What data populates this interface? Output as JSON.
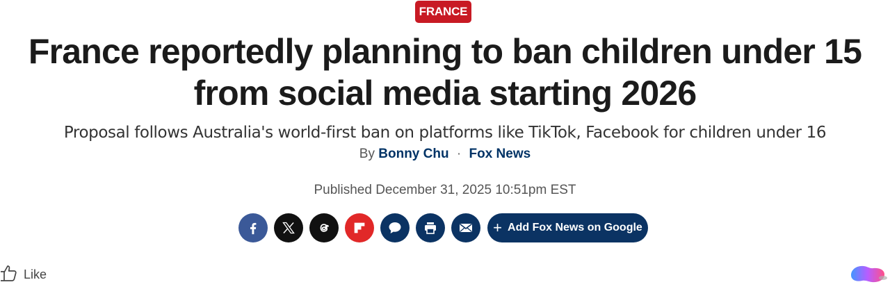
{
  "category": {
    "label": "FRANCE",
    "color": "#c81a24"
  },
  "article": {
    "headline_line1": "France reportedly planning to ban children under 15",
    "headline_line2": "from social media starting 2026",
    "subheadline": "Proposal follows Australia's world-first ban on platforms like TikTok, Facebook for children under 16",
    "byline": {
      "prefix": "By",
      "author": "Bonny Chu",
      "separator": "·",
      "outlet": "Fox News"
    },
    "published": "Published December 31, 2025 10:51pm EST"
  },
  "share": {
    "buttons": [
      {
        "name": "facebook",
        "icon": "facebook-icon"
      },
      {
        "name": "x",
        "icon": "x-icon"
      },
      {
        "name": "threads",
        "icon": "threads-icon"
      },
      {
        "name": "flipboard",
        "icon": "flipboard-icon"
      },
      {
        "name": "comments",
        "icon": "chat-bubble-icon"
      },
      {
        "name": "print",
        "icon": "print-icon"
      },
      {
        "name": "email",
        "icon": "email-icon"
      }
    ],
    "google_button": {
      "plus": "+",
      "label": "Add Fox News on Google"
    }
  },
  "reactions": {
    "like_label": "Like"
  },
  "colors": {
    "navy": "#0b3363",
    "red": "#c81a24",
    "facebook": "#3b5998"
  }
}
